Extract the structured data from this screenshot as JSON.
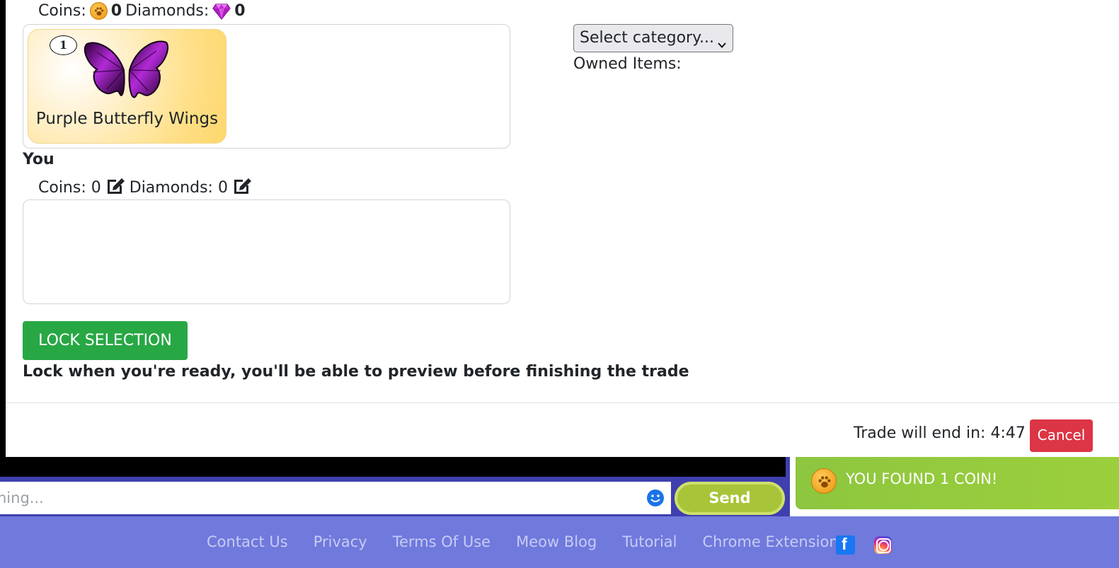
{
  "partner": {
    "coins_label": "Coins:",
    "coins": "0",
    "diamonds_label": "Diamonds:",
    "diamonds": "0",
    "items": [
      {
        "quantity": "1",
        "name": "Purple Butterfly Wings",
        "icon": "purple-butterfly-wings"
      }
    ]
  },
  "you": {
    "label": "You",
    "coins_text": "Coins: 0",
    "diamonds_text": "Diamonds: 0"
  },
  "inventory": {
    "category_select": "Select category...",
    "owned_label": "Owned Items:"
  },
  "actions": {
    "lock_label": "LOCK SELECTION",
    "lock_hint": "Lock when you're ready, you'll be able to preview before finishing the trade",
    "timer_text": "Trade will end in: 4:47",
    "cancel_label": "Cancel"
  },
  "chat": {
    "input_partial": "hing...",
    "emoji_icon": "smiley-icon",
    "send_label": "Send"
  },
  "toast": {
    "text": "YOU FOUND 1 COIN!"
  },
  "footer": {
    "links": [
      "Contact Us",
      "Privacy",
      "Terms Of Use",
      "Meow Blog",
      "Tutorial",
      "Chrome Extension"
    ],
    "social": [
      "facebook",
      "instagram"
    ]
  },
  "colors": {
    "lock_button": "#28a745",
    "cancel_button": "#dc3545",
    "footer_bg": "#7079dc",
    "toast_bg": "#8dc63f",
    "send_button": "#a8c53a"
  }
}
